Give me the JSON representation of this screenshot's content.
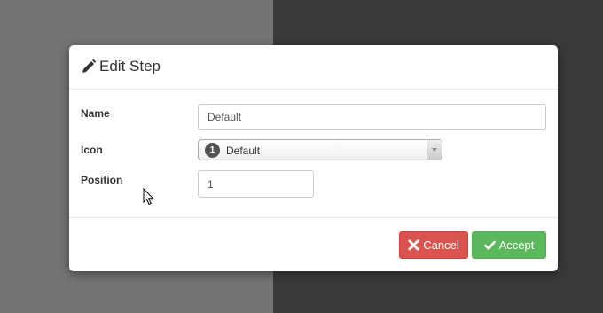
{
  "modal": {
    "title": "Edit Step",
    "title_icon": "pencil-icon"
  },
  "form": {
    "name": {
      "label": "Name",
      "value": "Default"
    },
    "icon": {
      "label": "Icon",
      "badge": "1",
      "selected": "Default"
    },
    "position": {
      "label": "Position",
      "value": "1"
    }
  },
  "footer": {
    "cancel_label": "Cancel",
    "cancel_icon": "x-icon",
    "accept_label": "Accept",
    "accept_icon": "check-icon"
  },
  "colors": {
    "cancel": "#d9534f",
    "accept": "#5cb85c",
    "backdrop_left": "#747474",
    "backdrop_right": "#3a3a3a"
  }
}
